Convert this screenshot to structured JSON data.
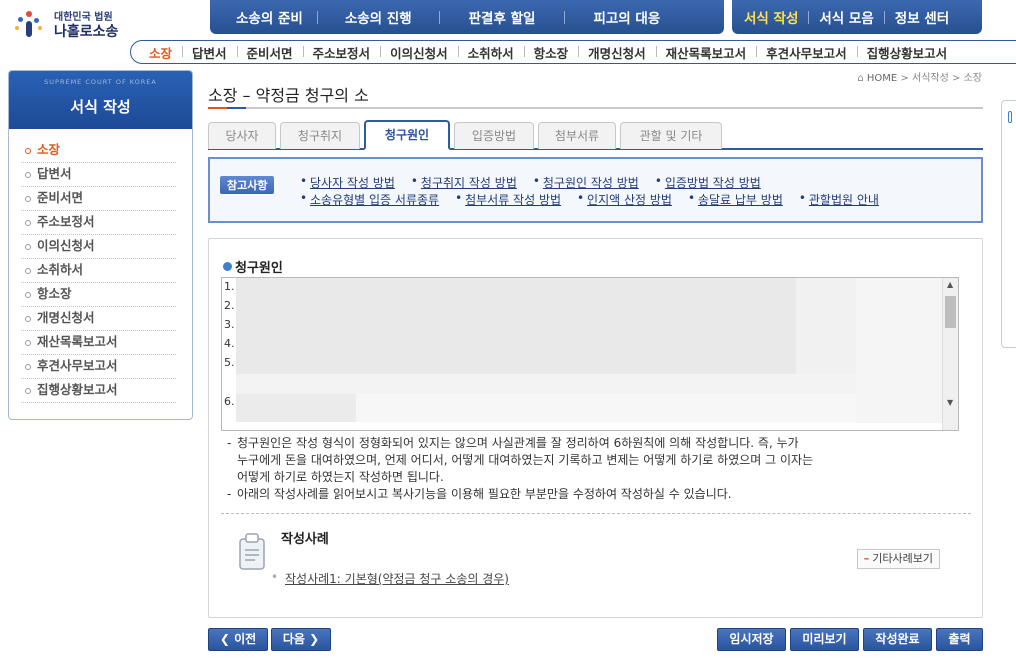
{
  "logo": {
    "line1": "대한민국 법원",
    "line2": "나홀로소송"
  },
  "topnav": {
    "group1": [
      "소송의 준비",
      "소송의 진행",
      "판결후 할일",
      "피고의 대응"
    ],
    "group2": [
      "서식 작성",
      "서식 모음",
      "정보 센터"
    ]
  },
  "subnav": [
    "소장",
    "답변서",
    "준비서면",
    "주소보정서",
    "이의신청서",
    "소취하서",
    "항소장",
    "개명신청서",
    "재산목록보고서",
    "후견사무보고서",
    "집행상황보고서"
  ],
  "sidebar": {
    "supertitle": "SUPREME COURT OF KOREA",
    "title": "서식 작성",
    "items": [
      "소장",
      "답변서",
      "준비서면",
      "주소보정서",
      "이의신청서",
      "소취하서",
      "항소장",
      "개명신청서",
      "재산목록보고서",
      "후견사무보고서",
      "집행상황보고서"
    ]
  },
  "breadcrumb": {
    "home": "HOME",
    "sep1": ">",
    "level1": "서식작성",
    "sep2": ">",
    "level2": "소장"
  },
  "page": {
    "title": "소장 – 약정금 청구의 소"
  },
  "tabs": [
    "당사자",
    "청구취지",
    "청구원인",
    "입증방법",
    "첨부서류",
    "관할 및 기타"
  ],
  "reference": {
    "badge": "참고사항",
    "row1": [
      "당사자 작성 방법",
      "청구취지 작성 방법",
      "청구원인 작성 방법",
      "입증방법 작성 방법"
    ],
    "row2": [
      "소송유형별 입증 서류종류",
      "첨부서류 작성 방법",
      "인지액 산정 방법",
      "송달료 납부 방법",
      "관할법원 안내"
    ]
  },
  "main": {
    "section_title": "청구원인",
    "line_numbers": [
      "1.",
      "2.",
      "3.",
      "4.",
      "5.",
      "6."
    ],
    "notes": [
      "청구원인은 작성 형식이 정형화되어 있지는 않으며 사실관계를 잘 정리하여 6하원칙에 의해 작성합니다. 즉, 누가",
      "누구에게 돈을 대여하였으며, 언제 어디서, 어떻게 대여하였는지 기록하고 변제는 어떻게 하기로 하였으며 그 이자는",
      "어떻게 하기로 하였는지 작성하면 됩니다.",
      "아래의 작성사례를 읽어보시고 복사기능을 이용해 필요한 부분만을 수정하여 작성하실 수 있습니다."
    ],
    "example_title": "작성사례",
    "example_item": "작성사례1: 기본형(약정금 청구 소송의 경우)",
    "more_button": "기타사례보기"
  },
  "buttons": {
    "prev": "이전",
    "next": "다음",
    "temp_save": "임시저장",
    "preview": "미리보기",
    "complete": "작성완료",
    "print": "출력"
  },
  "colors": {
    "accent": "#e2571b",
    "brand": "#2f5a9e"
  }
}
